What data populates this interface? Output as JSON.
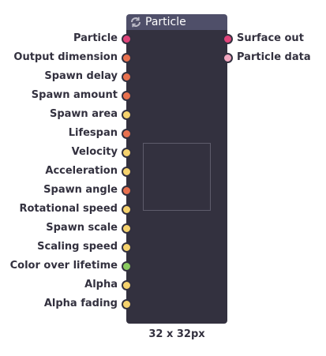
{
  "node": {
    "title": "Particle",
    "icon": "refresh-icon",
    "dimension_text": "32 x 32px",
    "colors": {
      "header": "#4f4f69",
      "body": "#33313f",
      "preview_border": "#5e5c6c"
    }
  },
  "inputs": [
    {
      "label": "Particle",
      "color": "#e0447a"
    },
    {
      "label": "Output dimension",
      "color": "#e8714f"
    },
    {
      "label": "Spawn delay",
      "color": "#e8714f"
    },
    {
      "label": "Spawn amount",
      "color": "#e8714f"
    },
    {
      "label": "Spawn area",
      "color": "#f5d26d"
    },
    {
      "label": "Lifespan",
      "color": "#e8714f"
    },
    {
      "label": "Velocity",
      "color": "#f5d26d"
    },
    {
      "label": "Acceleration",
      "color": "#f5d26d"
    },
    {
      "label": "Spawn angle",
      "color": "#e8714f"
    },
    {
      "label": "Rotational speed",
      "color": "#f5d26d"
    },
    {
      "label": "Spawn scale",
      "color": "#f5d26d"
    },
    {
      "label": "Scaling speed",
      "color": "#f5d26d"
    },
    {
      "label": "Color over lifetime",
      "color": "#8acb5f"
    },
    {
      "label": "Alpha",
      "color": "#f5d26d"
    },
    {
      "label": "Alpha fading",
      "color": "#f5d26d"
    }
  ],
  "outputs": [
    {
      "label": "Surface out",
      "color": "#e0447a"
    },
    {
      "label": "Particle data",
      "color": "#f2a7c0"
    }
  ]
}
